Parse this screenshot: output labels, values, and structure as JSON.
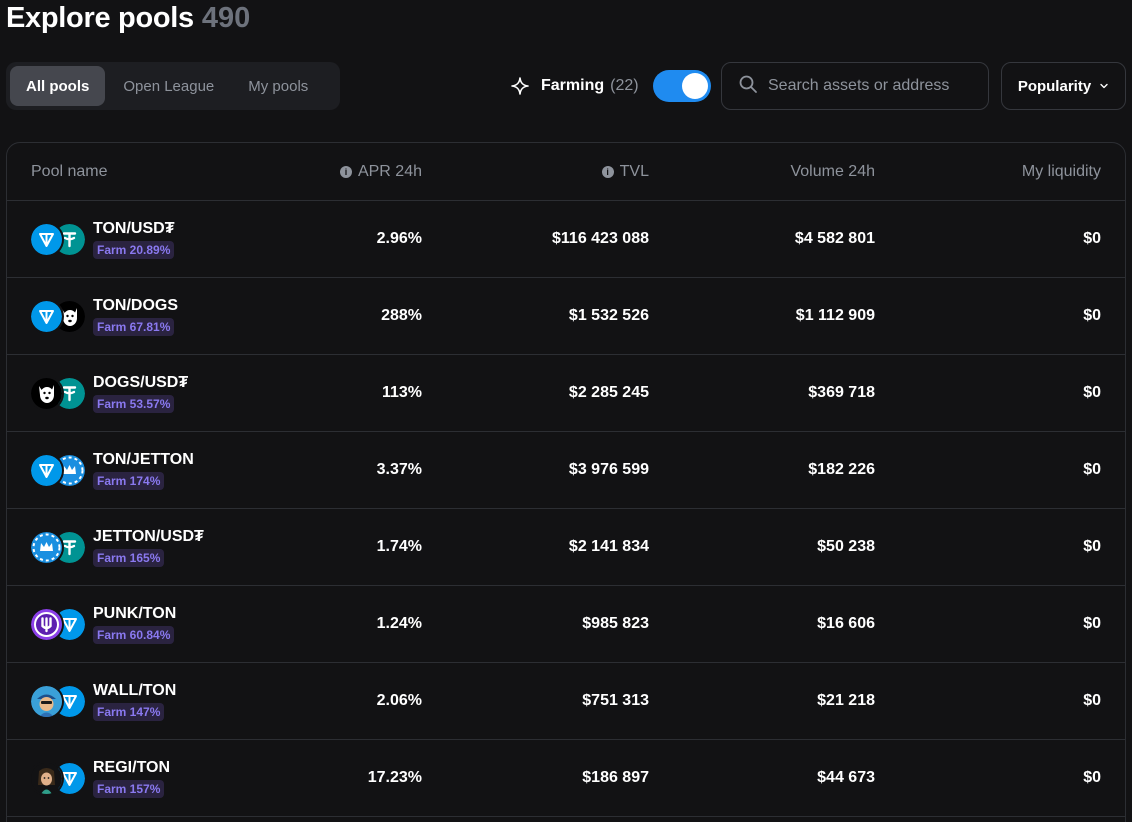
{
  "header": {
    "title": "Explore pools",
    "count": "490"
  },
  "tabs": [
    {
      "label": "All pools",
      "active": true
    },
    {
      "label": "Open League",
      "active": false
    },
    {
      "label": "My pools",
      "active": false
    }
  ],
  "farming": {
    "label": "Farming",
    "count": "(22)",
    "toggle_on": true
  },
  "search": {
    "placeholder": "Search assets or address",
    "value": ""
  },
  "sort": {
    "label": "Popularity"
  },
  "table": {
    "columns": {
      "pool_name": "Pool name",
      "apr": "APR 24h",
      "tvl": "TVL",
      "volume": "Volume 24h",
      "liquidity": "My liquidity"
    },
    "rows": [
      {
        "pair": "TON/USD₮",
        "farm": "Farm 20.89%",
        "apr": "2.96%",
        "tvl": "$116 423 088",
        "volume": "$4 582 801",
        "liquidity": "$0"
      },
      {
        "pair": "TON/DOGS",
        "farm": "Farm 67.81%",
        "apr": "288%",
        "tvl": "$1 532 526",
        "volume": "$1 112 909",
        "liquidity": "$0"
      },
      {
        "pair": "DOGS/USD₮",
        "farm": "Farm 53.57%",
        "apr": "113%",
        "tvl": "$2 285 245",
        "volume": "$369 718",
        "liquidity": "$0"
      },
      {
        "pair": "TON/JETTON",
        "farm": "Farm 174%",
        "apr": "3.37%",
        "tvl": "$3 976 599",
        "volume": "$182 226",
        "liquidity": "$0"
      },
      {
        "pair": "JETTON/USD₮",
        "farm": "Farm 165%",
        "apr": "1.74%",
        "tvl": "$2 141 834",
        "volume": "$50 238",
        "liquidity": "$0"
      },
      {
        "pair": "PUNK/TON",
        "farm": "Farm 60.84%",
        "apr": "1.24%",
        "tvl": "$985 823",
        "volume": "$16 606",
        "liquidity": "$0"
      },
      {
        "pair": "WALL/TON",
        "farm": "Farm 147%",
        "apr": "2.06%",
        "tvl": "$751 313",
        "volume": "$21 218",
        "liquidity": "$0"
      },
      {
        "pair": "REGI/TON",
        "farm": "Farm 157%",
        "apr": "17.23%",
        "tvl": "$186 897",
        "volume": "$44 673",
        "liquidity": "$0"
      }
    ]
  },
  "token_icons": {
    "TON": "ton-icon",
    "USD₮": "usdt-icon",
    "DOGS": "dogs-icon",
    "JETTON": "jetton-icon",
    "PUNK": "punk-icon",
    "WALL": "wall-icon",
    "REGI": "regi-icon"
  },
  "colors": {
    "accent": "#1f8bf0",
    "farm_text": "#8a79f0",
    "farm_bg": "#2a2340",
    "background": "#121214",
    "ton": "#0098ea",
    "usdt": "#009393",
    "jetton": "#1a8fe0",
    "punk": "#8b3fe8"
  }
}
